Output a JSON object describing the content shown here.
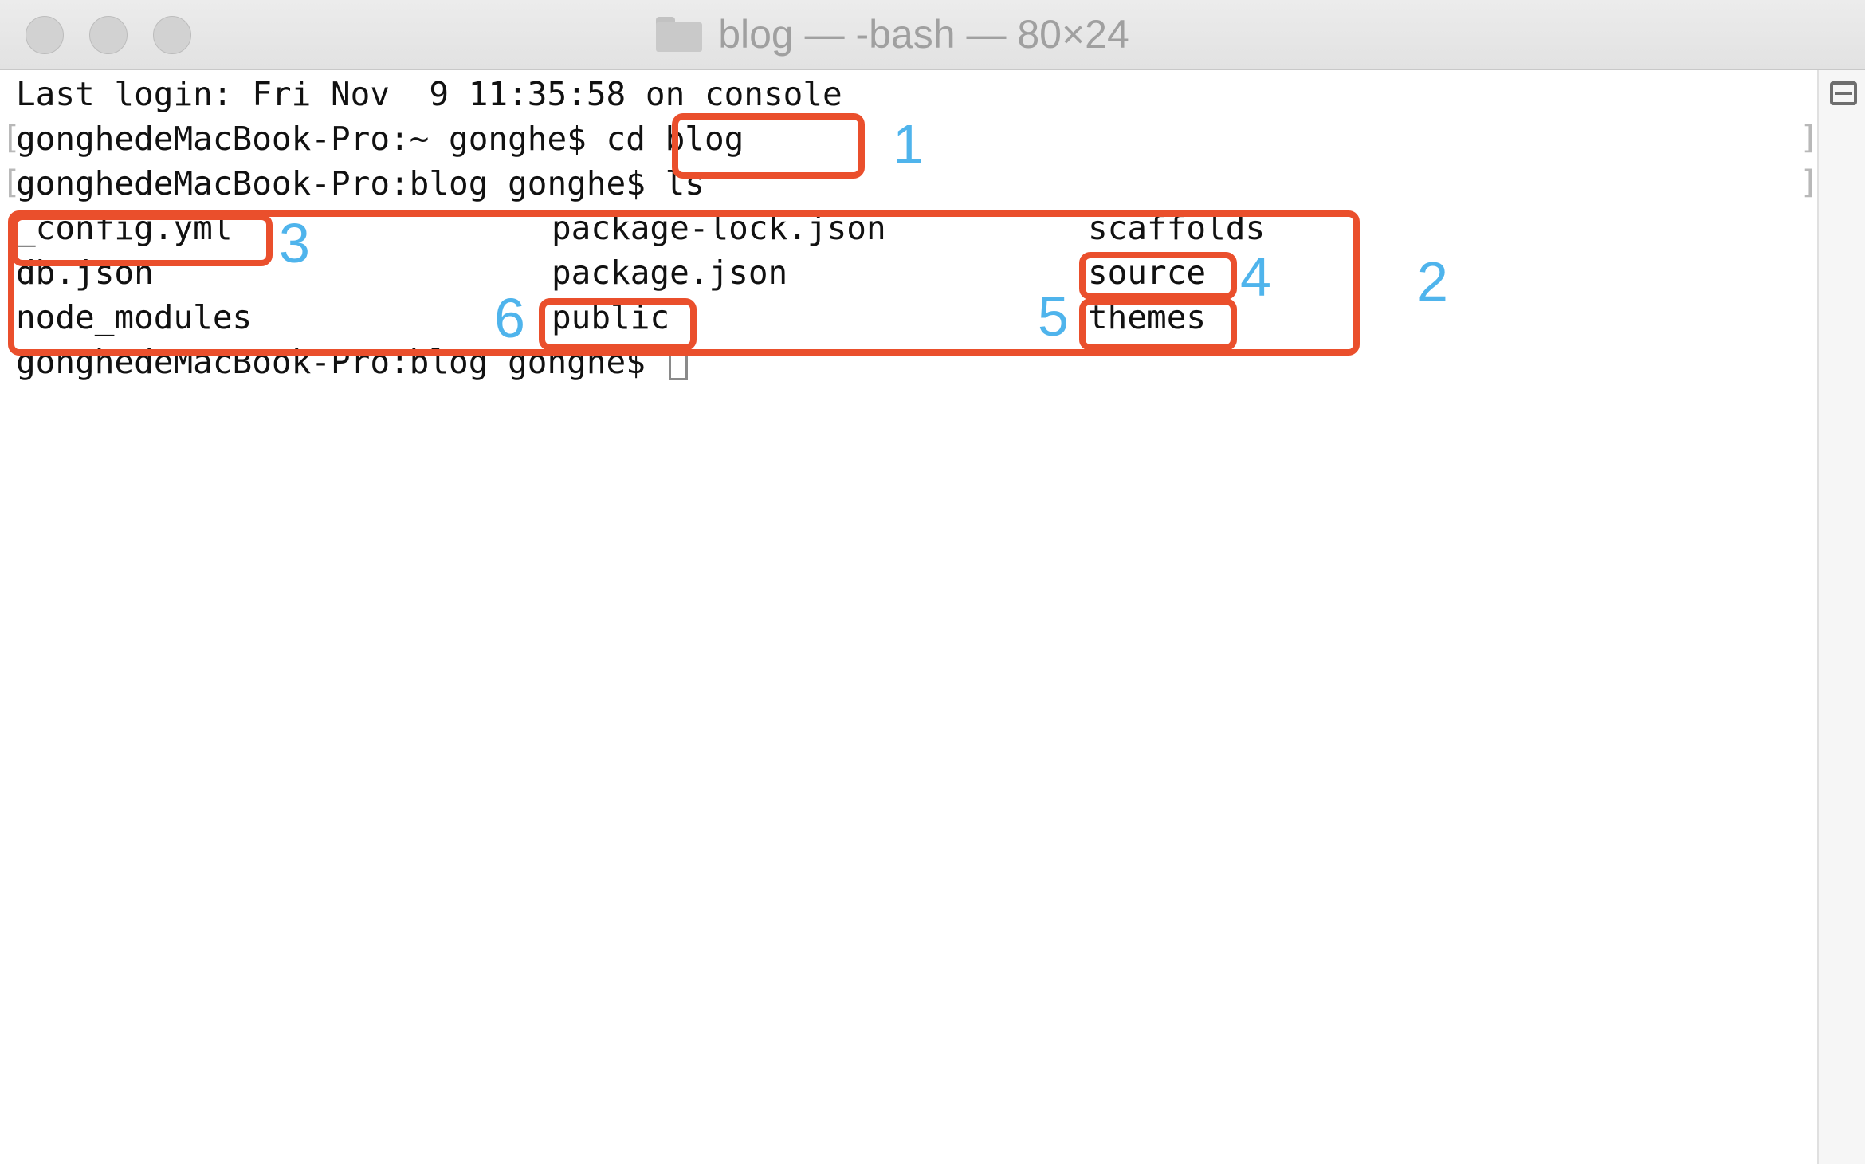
{
  "window": {
    "title": "blog — -bash — 80×24",
    "folder_icon": "folder-icon",
    "controls": [
      "close",
      "minimize",
      "zoom"
    ]
  },
  "terminal": {
    "line1": "Last login: Fri Nov  9 11:35:58 on console",
    "line2_prompt": "gonghedeMacBook-Pro:~ gonghe$ ",
    "line2_cmd": "cd blog",
    "line3_prompt": "gonghedeMacBook-Pro:blog gonghe$ ",
    "line3_cmd": "ls",
    "ls_output": [
      [
        "_config.yml",
        "package-lock.json",
        "scaffolds"
      ],
      [
        "db.json",
        "package.json",
        "source"
      ],
      [
        "node_modules",
        "public",
        "themes"
      ]
    ],
    "line7_prompt": "gonghedeMacBook-Pro:blog gonghe$ "
  },
  "annotations": {
    "label_1": "1",
    "label_2": "2",
    "label_3": "3",
    "label_4": "4",
    "label_5": "5",
    "label_6": "6",
    "box_color": "#ea4f2c",
    "label_color": "#4fb4ec"
  },
  "scrollbar": {
    "split_pane_icon": "split-pane-icon"
  }
}
